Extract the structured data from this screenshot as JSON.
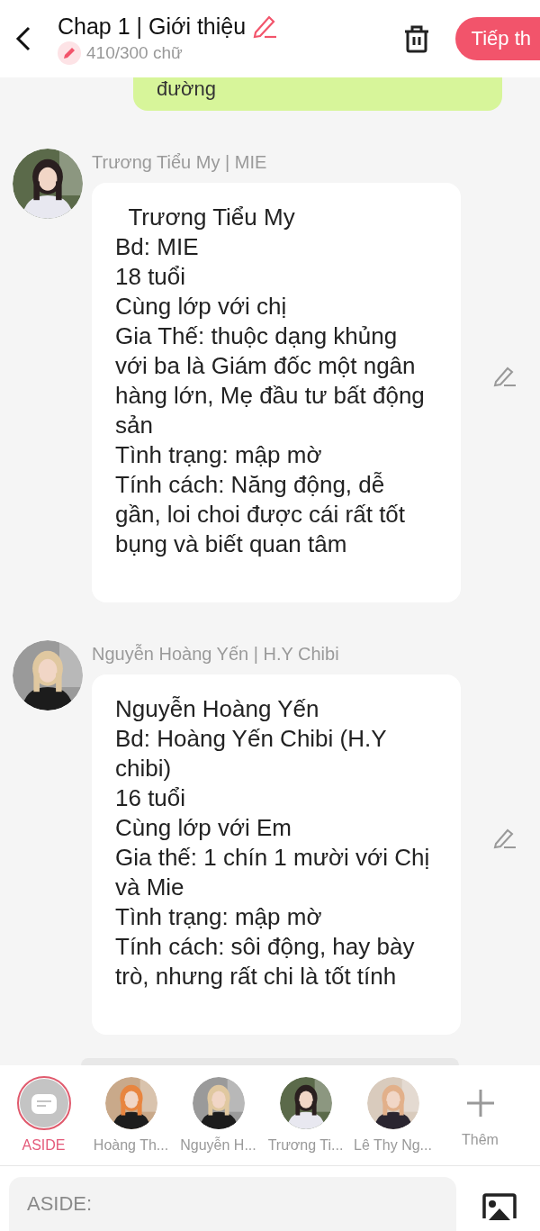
{
  "header": {
    "title": "Chap 1 | Giới thiệu",
    "word_count": "410/300 chữ",
    "next_button": "Tiếp th"
  },
  "previous_message": {
    "text": "đường"
  },
  "messages": [
    {
      "sender": "Trương Tiểu My | MIE",
      "lines": [
        "  Trương Tiểu My",
        "Bd: MIE",
        "18 tuổi",
        "Cùng lớp với chị",
        "Gia Thế: thuộc dạng khủng với ba là Giám đốc một ngân hàng lớn, Mẹ đầu tư bất động sản",
        "Tình trạng: mập mờ",
        "Tính cách: Năng động, dễ gần, loi choi được cái rất tốt bụng và biết quan tâm"
      ]
    },
    {
      "sender": "Nguyễn Hoàng Yến | H.Y Chibi",
      "lines": [
        "Nguyễn Hoàng Yến",
        "Bd: Hoàng Yến Chibi (H.Y chibi)",
        "16 tuổi",
        "Cùng lớp với Em",
        "Gia thế: 1 chín 1 mười với Chị và Mie",
        "Tình trạng: mập mờ",
        "Tính cách: sôi động, hay bày trò, nhưng rất chi là tốt tính"
      ]
    }
  ],
  "characters": [
    {
      "kind": "aside",
      "label": "ASIDE",
      "selected": true
    },
    {
      "kind": "person",
      "label": "Hoàng Th...",
      "selected": false
    },
    {
      "kind": "person",
      "label": "Nguyễn H...",
      "selected": false
    },
    {
      "kind": "person",
      "label": "Trương Ti...",
      "selected": false
    },
    {
      "kind": "person",
      "label": "Lê Thy Ng...",
      "selected": false
    },
    {
      "kind": "add",
      "label": "Thêm",
      "selected": false
    }
  ],
  "input": {
    "placeholder": "ASIDE:"
  }
}
